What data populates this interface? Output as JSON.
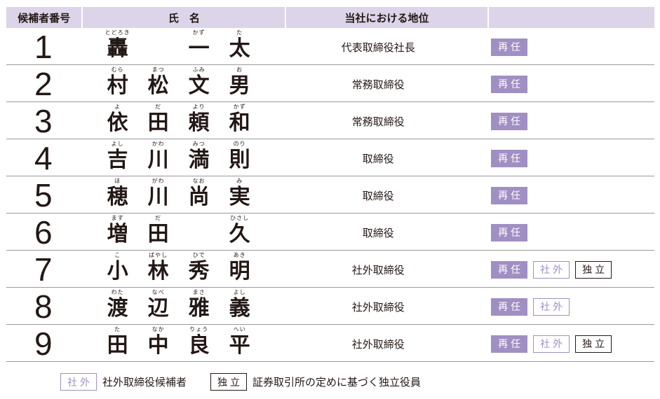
{
  "header": {
    "col_number": "候補者番号",
    "col_name": "氏　名",
    "col_position": "当社における地位",
    "col_badges": ""
  },
  "candidates": [
    {
      "number": "1",
      "chars": [
        {
          "ruby": "とどろき",
          "kanji": "轟"
        },
        {
          "ruby": "",
          "kanji": ""
        },
        {
          "ruby": "かず",
          "kanji": "一"
        },
        {
          "ruby": "た",
          "kanji": "太"
        }
      ],
      "position": "代表取締役社長",
      "badges": [
        "再任"
      ]
    },
    {
      "number": "2",
      "chars": [
        {
          "ruby": "むら",
          "kanji": "村"
        },
        {
          "ruby": "まつ",
          "kanji": "松"
        },
        {
          "ruby": "ふみ",
          "kanji": "文"
        },
        {
          "ruby": "お",
          "kanji": "男"
        }
      ],
      "position": "常務取締役",
      "badges": [
        "再任"
      ]
    },
    {
      "number": "3",
      "chars": [
        {
          "ruby": "よ",
          "kanji": "依"
        },
        {
          "ruby": "だ",
          "kanji": "田"
        },
        {
          "ruby": "より",
          "kanji": "頼"
        },
        {
          "ruby": "かず",
          "kanji": "和"
        }
      ],
      "position": "常務取締役",
      "badges": [
        "再任"
      ]
    },
    {
      "number": "4",
      "chars": [
        {
          "ruby": "よし",
          "kanji": "吉"
        },
        {
          "ruby": "かわ",
          "kanji": "川"
        },
        {
          "ruby": "みつ",
          "kanji": "満"
        },
        {
          "ruby": "のり",
          "kanji": "則"
        }
      ],
      "position": "取締役",
      "badges": [
        "再任"
      ]
    },
    {
      "number": "5",
      "chars": [
        {
          "ruby": "ほ",
          "kanji": "穂"
        },
        {
          "ruby": "がわ",
          "kanji": "川"
        },
        {
          "ruby": "なお",
          "kanji": "尚"
        },
        {
          "ruby": "み",
          "kanji": "実"
        }
      ],
      "position": "取締役",
      "badges": [
        "再任"
      ]
    },
    {
      "number": "6",
      "chars": [
        {
          "ruby": "ます",
          "kanji": "増"
        },
        {
          "ruby": "だ",
          "kanji": "田"
        },
        {
          "ruby": "",
          "kanji": ""
        },
        {
          "ruby": "ひさし",
          "kanji": "久"
        }
      ],
      "position": "取締役",
      "badges": [
        "再任"
      ]
    },
    {
      "number": "7",
      "chars": [
        {
          "ruby": "こ",
          "kanji": "小"
        },
        {
          "ruby": "ばやし",
          "kanji": "林"
        },
        {
          "ruby": "ひで",
          "kanji": "秀"
        },
        {
          "ruby": "あき",
          "kanji": "明"
        }
      ],
      "position": "社外取締役",
      "badges": [
        "再任",
        "社外",
        "独立"
      ]
    },
    {
      "number": "8",
      "chars": [
        {
          "ruby": "わた",
          "kanji": "渡"
        },
        {
          "ruby": "なべ",
          "kanji": "辺"
        },
        {
          "ruby": "まさ",
          "kanji": "雅"
        },
        {
          "ruby": "よし",
          "kanji": "義"
        }
      ],
      "position": "社外取締役",
      "badges": [
        "再任",
        "社外"
      ]
    },
    {
      "number": "9",
      "chars": [
        {
          "ruby": "た",
          "kanji": "田"
        },
        {
          "ruby": "なか",
          "kanji": "中"
        },
        {
          "ruby": "りょう",
          "kanji": "良"
        },
        {
          "ruby": "へい",
          "kanji": "平"
        }
      ],
      "position": "社外取締役",
      "badges": [
        "再任",
        "社外",
        "独立"
      ]
    }
  ],
  "legend": {
    "outside_badge": "社外",
    "outside_text": "社外取締役候補者",
    "independent_badge": "独立",
    "independent_text": "証券取引所の定めに基づく独立役員"
  },
  "colors": {
    "header_bg": "#dcd4e8",
    "reappoint_bg": "#a08fc3",
    "outside_border": "#a08fc3",
    "independent_border": "#231815",
    "text": "#231815"
  }
}
